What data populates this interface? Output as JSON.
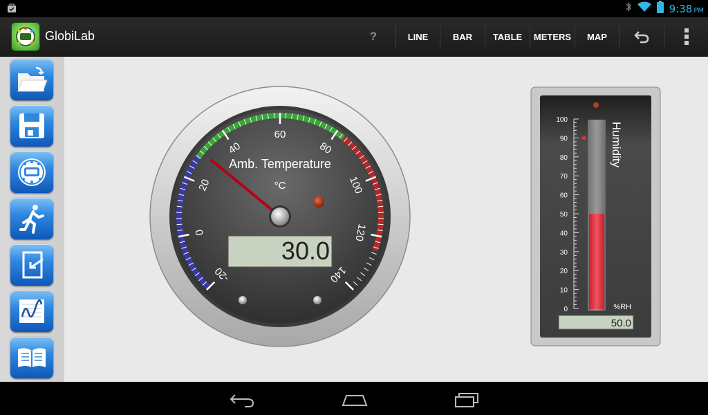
{
  "status_bar": {
    "time": "9:38",
    "ampm": "PM",
    "icons": [
      "notification-icon",
      "bluetooth-icon",
      "wifi-icon",
      "battery-icon"
    ]
  },
  "action_bar": {
    "app_title": "GlobiLab",
    "help_label": "?",
    "menu": [
      "LINE",
      "BAR",
      "TABLE",
      "METERS",
      "MAP"
    ]
  },
  "sidebar": {
    "buttons": [
      "open-folder-icon",
      "save-icon",
      "labdisc-icon",
      "runner-icon",
      "import-icon",
      "graph-icon",
      "book-icon"
    ]
  },
  "gauge": {
    "title": "Amb. Temperature",
    "unit": "°C",
    "value": "30.0",
    "min": -20,
    "max": 140,
    "ticks": [
      "-20",
      "0",
      "20",
      "40",
      "60",
      "80",
      "100",
      "120",
      "140"
    ],
    "needle_value": 30
  },
  "humidity": {
    "title": "Humidity",
    "unit": "%RH",
    "value": "50.0",
    "level": 50,
    "marker": 90,
    "scale": [
      "0",
      "10",
      "20",
      "30",
      "40",
      "50",
      "60",
      "70",
      "80",
      "90",
      "100"
    ]
  },
  "colors": {
    "accent": "#33b5e5",
    "green_zone": "#3aa53a",
    "red_zone": "#b02a2a",
    "blue_zone": "#3a3aa5",
    "needle": "#b3001b",
    "lcd": "#c8d2c0",
    "fill": "#e0323c"
  }
}
